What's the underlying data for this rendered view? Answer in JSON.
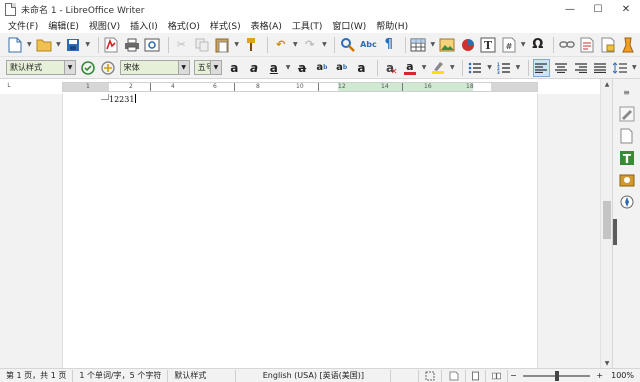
{
  "window": {
    "title": "未命名 1 - LibreOffice Writer",
    "controls": {
      "minimize": "—",
      "maximize": "☐",
      "close": "✕"
    }
  },
  "menu": [
    "文件(F)",
    "编辑(E)",
    "视图(V)",
    "插入(I)",
    "格式(O)",
    "样式(S)",
    "表格(A)",
    "工具(T)",
    "窗口(W)",
    "帮助(H)"
  ],
  "formatting": {
    "paragraph_style": "默认样式",
    "font_name": "宋体",
    "font_size": "五号"
  },
  "ruler": {
    "numbers": [
      "1",
      "2",
      "4",
      "6",
      "8",
      "10",
      "12",
      "14",
      "16",
      "18"
    ]
  },
  "document": {
    "text": "12231"
  },
  "statusbar": {
    "page": "第 1 页，共 1 页",
    "words": "1 个单词/字，5 个字符",
    "style": "默认样式",
    "language": "English (USA) [英语(美国)]",
    "zoom": "100%"
  },
  "colors": {
    "combo_bg": "#e6f0d8",
    "ruler_highlight": "#cfe9d3",
    "toolbar_bg": "#f2f2f2",
    "font_color_bar": "#d9262c",
    "highlight_bar": "#f4e400",
    "active_align": "#cfe3f5"
  }
}
